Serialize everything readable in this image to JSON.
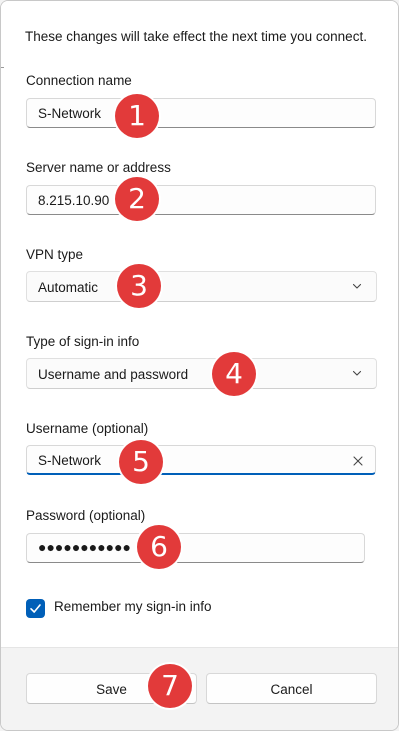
{
  "notice": "These changes will take effect the next time you connect.",
  "connection_name": {
    "label": "Connection name",
    "value": "S-Network",
    "marker": "1"
  },
  "server": {
    "label": "Server name or address",
    "value": "8.215.10.90",
    "marker": "2"
  },
  "vpn_type": {
    "label": "VPN type",
    "selected": "Automatic",
    "marker": "3"
  },
  "sign_in_type": {
    "label": "Type of sign-in info",
    "selected": "Username and password",
    "marker": "4"
  },
  "username": {
    "label": "Username (optional)",
    "value": "S-Network",
    "marker": "5"
  },
  "password": {
    "label": "Password (optional)",
    "value": "●●●●●●●●●●●",
    "marker": "6"
  },
  "remember": {
    "label": "Remember my sign-in info",
    "checked": true
  },
  "footer": {
    "save_label": "Save",
    "cancel_label": "Cancel",
    "marker": "7"
  },
  "colors": {
    "accent": "#005fb8",
    "marker": "#e23a3a"
  }
}
